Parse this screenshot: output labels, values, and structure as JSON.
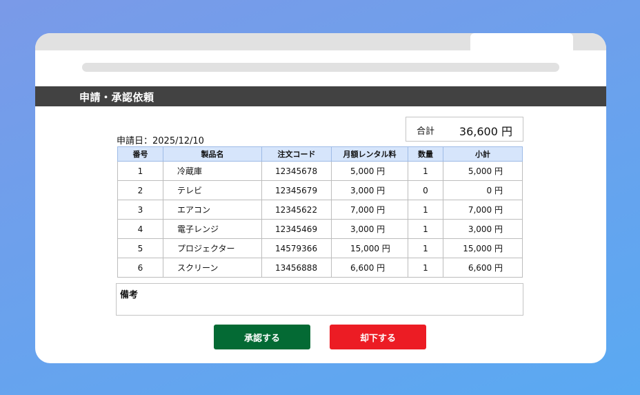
{
  "browser": {
    "close_glyph": "✕"
  },
  "page": {
    "title": "申請・承認依頼"
  },
  "summary": {
    "total_label": "合計",
    "total_value": "36,600 円"
  },
  "application": {
    "date_label": "申請日：",
    "date_value": "2025/12/10"
  },
  "table": {
    "headers": [
      "番号",
      "製品名",
      "注文コード",
      "月額レンタル料",
      "数量",
      "小計"
    ],
    "rows": [
      {
        "no": "1",
        "name": "冷蔵庫",
        "code": "12345678",
        "price": "5,000 円",
        "qty": "1",
        "subtotal": "5,000 円"
      },
      {
        "no": "2",
        "name": "テレビ",
        "code": "12345679",
        "price": "3,000 円",
        "qty": "0",
        "subtotal": "0 円"
      },
      {
        "no": "3",
        "name": "エアコン",
        "code": "12345622",
        "price": "7,000 円",
        "qty": "1",
        "subtotal": "7,000 円"
      },
      {
        "no": "4",
        "name": "電子レンジ",
        "code": "12345469",
        "price": "3,000 円",
        "qty": "1",
        "subtotal": "3,000 円"
      },
      {
        "no": "5",
        "name": "プロジェクター",
        "code": "14579366",
        "price": "15,000 円",
        "qty": "1",
        "subtotal": "15,000 円"
      },
      {
        "no": "6",
        "name": "スクリーン",
        "code": "13456888",
        "price": "6,600 円",
        "qty": "1",
        "subtotal": "6,600 円"
      }
    ]
  },
  "notes": {
    "label": "備考"
  },
  "actions": {
    "approve_label": "承認する",
    "reject_label": "却下する"
  },
  "colors": {
    "title_bar": "#424242",
    "header_fill": "#d6e5fb",
    "approve": "#046a34",
    "reject": "#ec1c24"
  }
}
